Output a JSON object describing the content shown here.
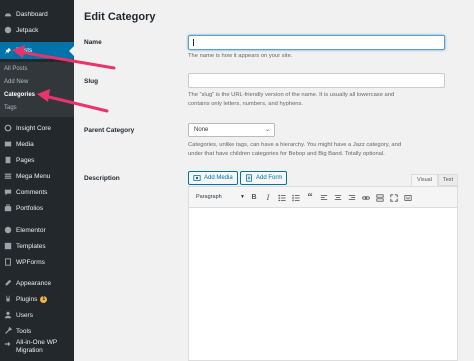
{
  "sidebar": {
    "items": [
      {
        "label": "Dashboard",
        "icon": "dashboard-icon"
      },
      {
        "label": "Jetpack",
        "icon": "jetpack-icon"
      },
      {
        "label": "Posts",
        "icon": "pin-icon"
      },
      {
        "label": "Insight Core",
        "icon": "insight-core-icon"
      },
      {
        "label": "Media",
        "icon": "media-icon"
      },
      {
        "label": "Pages",
        "icon": "pages-icon"
      },
      {
        "label": "Mega Menu",
        "icon": "mega-menu-icon"
      },
      {
        "label": "Comments",
        "icon": "comments-icon"
      },
      {
        "label": "Portfolios",
        "icon": "portfolios-icon"
      },
      {
        "label": "Elementor",
        "icon": "elementor-icon"
      },
      {
        "label": "Templates",
        "icon": "templates-icon"
      },
      {
        "label": "WPForms",
        "icon": "wpforms-icon"
      },
      {
        "label": "Appearance",
        "icon": "appearance-icon"
      },
      {
        "label": "Plugins",
        "icon": "plugins-icon",
        "badge": "1"
      },
      {
        "label": "Users",
        "icon": "users-icon"
      },
      {
        "label": "Tools",
        "icon": "tools-icon"
      },
      {
        "label": "All-in-One WP",
        "label2": "Migration",
        "icon": "migration-icon"
      }
    ],
    "submenu": [
      "All Posts",
      "Add New",
      "Categories",
      "Tags"
    ]
  },
  "main": {
    "title": "Edit Category",
    "name_label": "Name",
    "name_value": "",
    "name_help": "The name is how it appears on your site.",
    "slug_label": "Slug",
    "slug_value": "",
    "slug_help_1": "The “slug” is the URL-friendly version of the name. It is usually all lowercase and",
    "slug_help_2": "contains only letters, numbers, and hyphens.",
    "parent_label": "Parent Category",
    "parent_value": "None",
    "parent_help_1": "Categories, unlike tags, can have a hierarchy. You might have a Jazz category, and",
    "parent_help_2": "under that have children categories for Bebop and Big Band. Totally optional.",
    "description_label": "Description",
    "add_media": "Add Media",
    "add_form": "Add Form",
    "tab_visual": "Visual",
    "tab_text": "Text",
    "format_value": "Paragraph"
  },
  "colors": {
    "sidebar_bg": "#23282d",
    "active_bg": "#0073aa",
    "arrow": "#e8336d"
  }
}
